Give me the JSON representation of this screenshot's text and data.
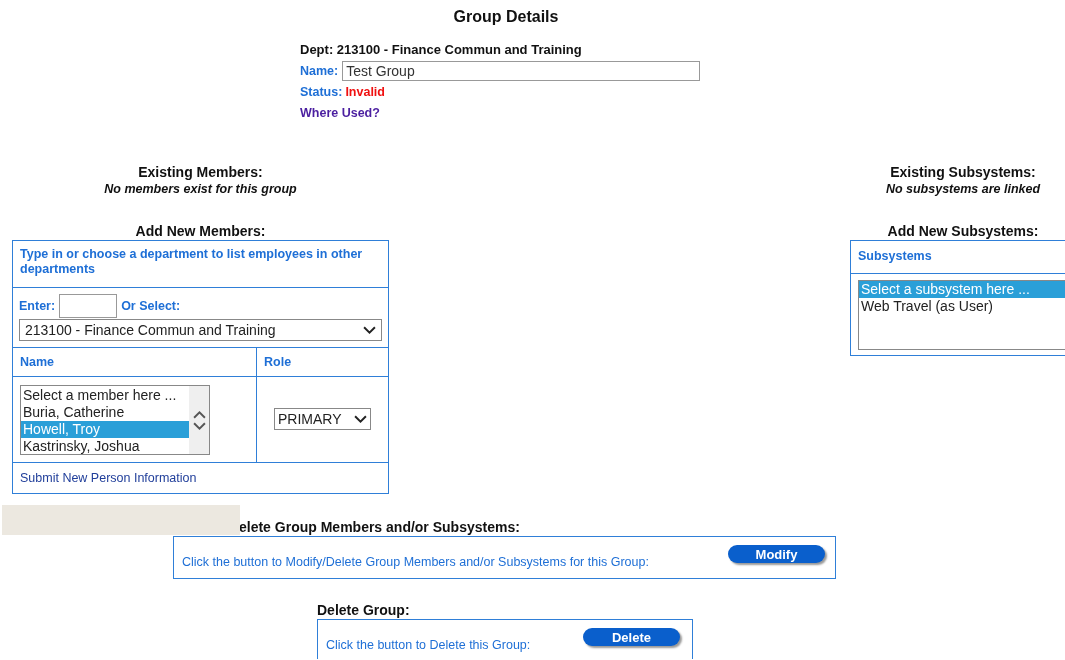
{
  "title": "Group Details",
  "group": {
    "dept": "Dept: 213100 - Finance Commun and Training",
    "name_label": "Name:",
    "name_value": "Test Group",
    "status_label": "Status:",
    "status_value": "Invalid",
    "where_used_link": "Where Used?"
  },
  "members": {
    "existing_heading": "Existing Members:",
    "existing_note": "No members exist for this group",
    "add_heading": "Add New Members:",
    "instructions": "Type in or choose a department to list employees in other departments",
    "enter_label": "Enter:",
    "or_select_label": "Or Select:",
    "department_select": "213100 - Finance Commun and Training",
    "columns": [
      "Name",
      "Role"
    ],
    "member_options": [
      {
        "label": "Select a member here ...",
        "selected": false
      },
      {
        "label": "Buria, Catherine",
        "selected": false
      },
      {
        "label": "Howell, Troy",
        "selected": true
      },
      {
        "label": "Kastrinsky, Joshua",
        "selected": false
      }
    ],
    "role_select": "PRIMARY",
    "submit_link": "Submit New Person Information"
  },
  "subsystems": {
    "existing_heading": "Existing Subsystems:",
    "existing_note": "No subsystems are linked",
    "add_heading": "Add New Subsystems:",
    "panel_heading": "Subsystems",
    "options": [
      {
        "label": "Select a subsystem here ...",
        "selected": true
      },
      {
        "label": "Web Travel (as User)",
        "selected": false
      }
    ]
  },
  "modify": {
    "heading": "elete Group Members and/or Subsystems:",
    "text": "Click the button to Modify/Delete Group Members and/or Subsystems for this Group:",
    "button": "Modify"
  },
  "delete": {
    "heading": "Delete Group:",
    "text": "Click the button to Delete this Group:",
    "button": "Delete"
  }
}
